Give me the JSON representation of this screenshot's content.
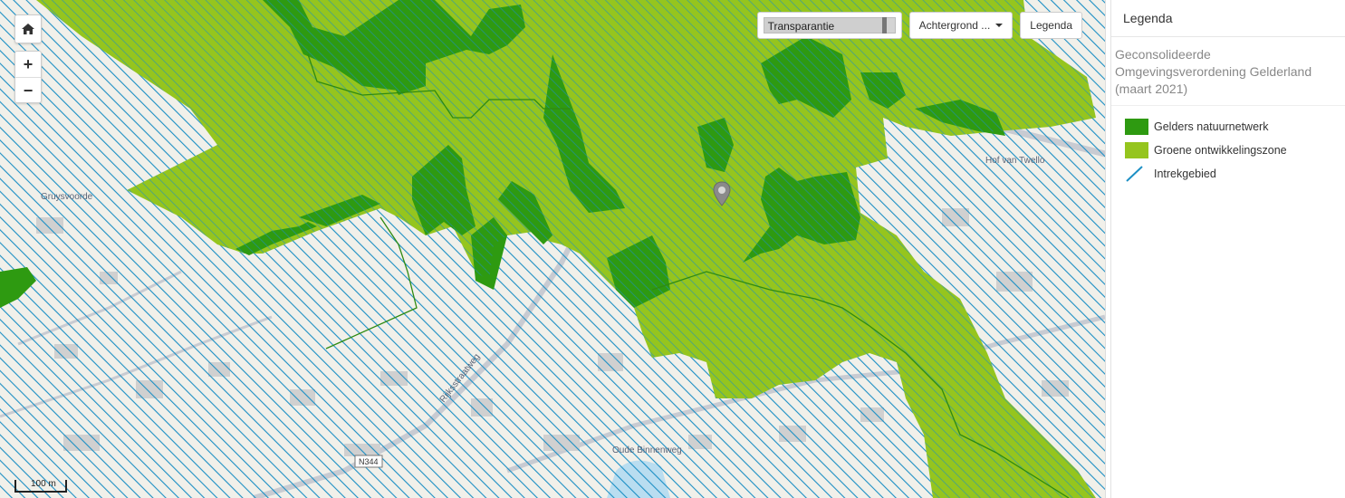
{
  "map": {
    "transparency_label": "Transparantie",
    "transparency_value": 0.94,
    "background_label": "Achtergrond ...",
    "legend_button_label": "Legenda",
    "scale_label": "100 m",
    "road_label": "N344",
    "labels": [
      {
        "text": "Gruysvoorde",
        "id": "gruysvoorde"
      },
      {
        "text": "Hof van Twello",
        "id": "hofvantwello"
      },
      {
        "text": "Oude Binnenweg",
        "id": "oudebinnenweg"
      },
      {
        "text": "Rijksstraatweg",
        "id": "rijksstraatweg"
      }
    ]
  },
  "legend": {
    "title": "Legenda",
    "subtitle": "Geconsolideerde Omgevingsverordening Gelderland (maart 2021)",
    "items": [
      {
        "label": "Gelders natuurnetwerk",
        "color": "#2e9a11"
      },
      {
        "label": "Groene ontwikkelingszone",
        "color": "#95c51e"
      },
      {
        "label": "Intrekgebied",
        "color": "#1c8fc4"
      }
    ]
  }
}
